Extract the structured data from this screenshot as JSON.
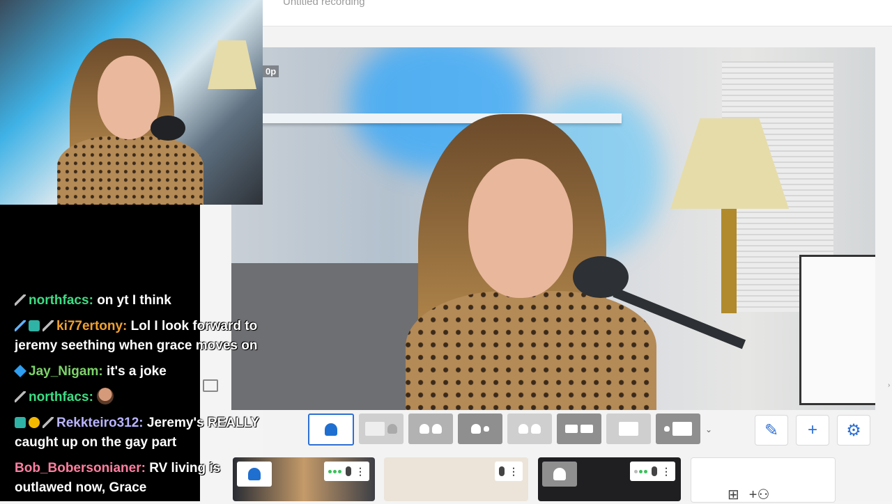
{
  "studio": {
    "recording_title": "Untitled recording",
    "stage_quality": "0p",
    "layouts": [
      {
        "id": "solo",
        "active": true
      },
      {
        "id": "thin"
      },
      {
        "id": "group"
      },
      {
        "id": "leader"
      },
      {
        "id": "split"
      },
      {
        "id": "news"
      },
      {
        "id": "screen"
      },
      {
        "id": "picture-in-picture"
      }
    ],
    "tools": {
      "edit": "pencil-icon",
      "add": "plus-icon",
      "settings": "gear-icon"
    },
    "tiles": [
      {
        "kind": "camera",
        "on_stage": true
      },
      {
        "kind": "camera",
        "on_stage": false
      },
      {
        "kind": "camera",
        "on_stage": false
      },
      {
        "kind": "add"
      }
    ]
  },
  "chat": {
    "messages": [
      {
        "badges": [
          "mod"
        ],
        "user": "northfacs:",
        "text": "on yt I think",
        "color": "#3ddc84"
      },
      {
        "badges": [
          "sword",
          "sub",
          "mod"
        ],
        "user": "ki77ertony:",
        "text": "Lol I look forward to jeremy seething when grace moves on",
        "color": "#f0a030"
      },
      {
        "badges": [
          "cube"
        ],
        "user": "Jay_Nigam:",
        "text": "it's a joke",
        "color": "#7dd36a"
      },
      {
        "badges": [
          "mod"
        ],
        "user": "northfacs:",
        "text": "",
        "emote": true,
        "color": "#3ddc84"
      },
      {
        "badges": [
          "sub",
          "gold",
          "mod"
        ],
        "user": "Rekkteiro312:",
        "text": "Jeremy's REALLY caught up on the gay part",
        "color": "#b9b4ff"
      },
      {
        "badges": [],
        "user": "Bob_Bobersonianer:",
        "text": "RV living is outlawed now, Grace",
        "color": "#ff7fa0"
      }
    ]
  }
}
